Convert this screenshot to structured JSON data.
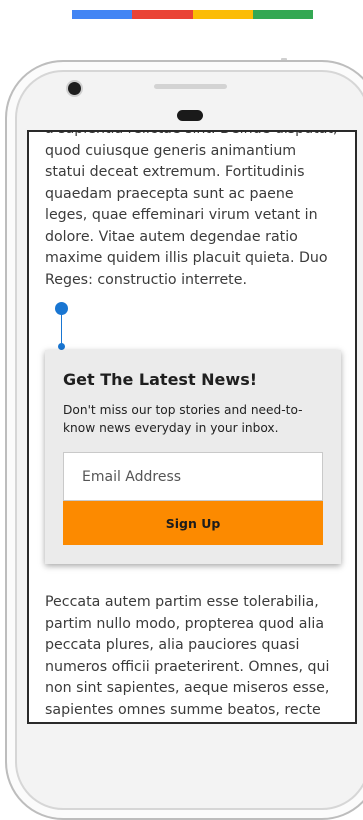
{
  "brand_colors": [
    "#4285f4",
    "#ea4335",
    "#fbbc05",
    "#34a853"
  ],
  "article": {
    "paragraph_top": "a sapientia relictae sint. Deinde disputat, quod cuiusque generis animantium statui deceat extremum. Fortitudinis quaedam praecepta sunt ac paene leges, quae effeminari virum vetant in dolore. Vitae autem degendae ratio maxime quidem illis placuit quieta. Duo Reges: constructio interrete.",
    "paragraph_bottom": "Peccata autem partim esse tolerabilia, partim nullo modo, propterea quod alia peccata plures, alia pauciores quasi numeros officii praeterirent. Omnes, qui non sint sapientes, aeque miseros esse, sapientes omnes summe beatos, recte facta omnia aequalia, omnia peccata paria; Ea"
  },
  "newsletter": {
    "title": "Get The Latest News!",
    "description": "Don't miss our top stories and need-to-know news everyday in your inbox.",
    "email_placeholder": "Email Address",
    "signup_label": "Sign Up",
    "button_color": "#fc8a00",
    "indicator_color": "#1976d2"
  }
}
